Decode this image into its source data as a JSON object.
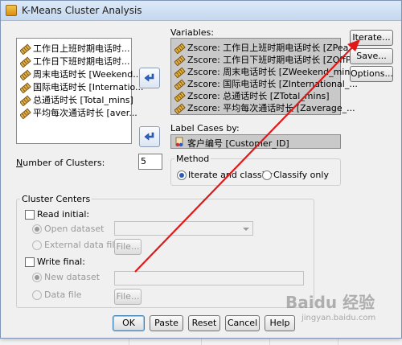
{
  "window": {
    "title": "K-Means Cluster Analysis"
  },
  "source_list": {
    "items": [
      "工作日上班时期电话时...",
      "工作日下班时期电话时...",
      "周末电话时长 [Weekend...",
      "国际电话时长 [Internatio...",
      "总通话时长 [Total_mins]",
      "平均每次通话时长 [aver..."
    ]
  },
  "variables": {
    "label": "Variables:",
    "items": [
      "Zscore:  工作日上班时期电话时长 [ZPea...",
      "Zscore:  工作日下班时期电话时长 [ZOffP...",
      "Zscore:  周末电话时长 [ZWeekend_mins]",
      "Zscore:  国际电话时长 [ZInternational_...",
      "Zscore:  总通话时长 [ZTotal_mins]",
      "Zscore:  平均每次通话时长 [Zaverage_..."
    ]
  },
  "label_cases": {
    "label": "Label Cases by:",
    "value": "客户编号 [Customer_ID]"
  },
  "clusters": {
    "label": "Number of Clusters:",
    "value": "5"
  },
  "method": {
    "title": "Method",
    "opt1": "Iterate and classify",
    "opt2": "Classify only"
  },
  "centers": {
    "title": "Cluster Centers",
    "read_initial": "Read initial:",
    "open_dataset": "Open dataset",
    "external_file": "External data file",
    "write_final": "Write final:",
    "new_dataset": "New dataset",
    "data_file": "Data file",
    "file_btn": "File..."
  },
  "side_buttons": {
    "iterate": "Iterate...",
    "save": "Save...",
    "options": "Options..."
  },
  "bottom_buttons": {
    "ok": "OK",
    "paste": "Paste",
    "reset": "Reset",
    "cancel": "Cancel",
    "help": "Help"
  },
  "watermark": {
    "text": "Baidu 经验",
    "sub": "jingyan.baidu.com"
  },
  "colors": {
    "annotation_arrow": "#e01818",
    "selection_bg": "#c9c9c9",
    "title_gradient": "#dce9f8"
  },
  "icons": [
    "ruler-icon",
    "add-arrow-icon",
    "case-label-icon",
    "window-icon"
  ]
}
